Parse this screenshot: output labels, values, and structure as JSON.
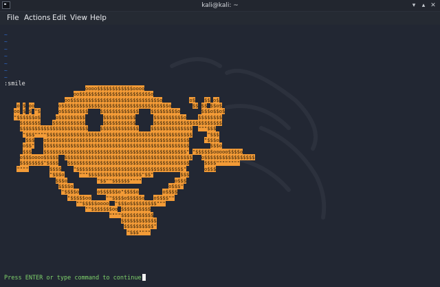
{
  "window": {
    "title": "kali@kali: ~"
  },
  "menu": [
    "File",
    "Actions",
    "Edit",
    "View",
    "Help"
  ],
  "editor": {
    "tildes": "~\n~\n~\n~\n~\n~\n~",
    "command": ":smile",
    "status": "Press ENTER or type command to continue"
  },
  "art_lines": [
    "                        oooo$$$$$$$$$$$$oooo",
    "                    oo$$$$$$$$$$$$$$$$$$$$$$$$o",
    "                 oo$$$$$$$$$$$$$$$$$$$$$$$$$$$$$$o         o$   $$ o$",
    " o $ oo        o$$$$$$$$$$$$$$$$$$$$$$$$$$$$$$$$$$$$o       $$ $$ $$o$",
    "oo $ $ \"$      o$$$$$$$$$    $$$$$$$$$$$$$    $$$$$$$$$o       $$$o$$o$",
    "\"$$$$$$o$     o$$$$$$$$$      $$$$$$$$$$$      $$$$$$$$$$o    $$$$$$$$",
    "  $$$$$$$    $$$$$$$$$$$      $$$$$$$$$$$      $$$$$$$$$$$$$$$$$$$$$$$",
    "  $$$$$$$$$$$$$$$$$$$$$$$    $$$$$$$$$$$$$    $$$$$$$$$$$$$$  \"\"\"$$$",
    "   \"$$$\"\"\"\"$$$$$$$$$$$$$$$$$$$$$$$$$$$$$$$$$$$$$$$$$$$$$$$$$     \"$$$",
    "    $$$   o$$$$$$$$$$$$$$$$$$$$$$$$$$$$$$$$$$$$$$$$$$$$$$$$     \"$$$o",
    "   o$$\"   $$$$$$$$$$$$$$$$$$$$$$$$$$$$$$$$$$$$$$$$$$$$$$$$$       $$$o",
    "   $$$    $$$$$$$$$$$$$$$$$$$$$$$$$$$$$$$$$$$$$$$$$$$$$$$$\" \"$$$$$$ooooo$$$$o",
    "  o$$$oooo$$$$$  $$$$$$$$$$$$$$$$$$$$$$$$$$$$$$$$$$$$$$$$$$$   o$$$$$$$$$$$$$$$$$",
    "  $$$$$$$$\"$$$$   $$$$$$$$$$$$$$$$$$$$$$$$$$$$$$$$$$$$$$$$$     $$$$\"\"\"\"\"\"\"\"",
    " \"\"\"\"       $$$$    \"$$$$$$$$$$$$$$$$$$$$$$$$$$$$$$$$$$$$\"      o$$$",
    "            \"$$$o     \"\"\"$$$$$$$$$$$$$$$$$$\"$$\"         $$$",
    "              $$$o          \"$$\"\"$$$$$$\"\"\"\"           o$$$",
    "               $$$$o                                o$$$\"",
    "                \"$$$$o      o$$$$$$o\"$$$$o        o$$$$",
    "                  \"$$$$$oo     \"\"$$$$o$$$$$o   o$$$$\"\"",
    "                     \"\"$$$$$oooo  \"$$$o$$$$$$$$$\"\"\"",
    "                        \"\"$$$$$$$oo $$$$$$$$$$",
    "                                \"\"\"\"$$$$$$$$$$$",
    "                                    $$$$$$$$$$$$",
    "                                     $$$$$$$$$$\"",
    "                                      \"$$$\"\"\"\""
  ],
  "colors": {
    "background": "#222733",
    "art": "#f39b37",
    "tilde": "#2e6fd8",
    "status": "#7fd36b"
  },
  "icons": [
    "terminal-icon",
    "minimize-icon",
    "maximize-icon",
    "close-icon"
  ]
}
